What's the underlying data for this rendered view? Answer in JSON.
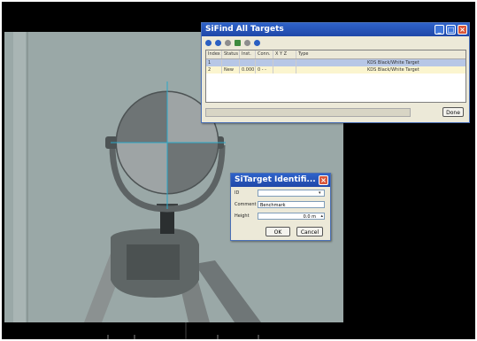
{
  "find_window": {
    "title": "SiFind All Targets",
    "columns": [
      "Index",
      "Status",
      "Inst.",
      "Conn.",
      "X Y Z",
      "Type"
    ],
    "rows": [
      {
        "index": "1",
        "status": "",
        "inst": "",
        "conn": "",
        "xyz": "",
        "type": "KDS Black/White Target"
      },
      {
        "index": "2",
        "status": "New",
        "inst": "0.000",
        "conn": "0 - -",
        "xyz": "",
        "type": "KDS Black/White Target"
      }
    ],
    "done_label": "Done"
  },
  "identify_window": {
    "title": "SiTarget Identifi...",
    "id_label": "ID",
    "id_value": "",
    "comment_label": "Comment",
    "comment_value": "Benchmark",
    "height_label": "Height",
    "height_value": "0.0 m",
    "ok_label": "OK",
    "cancel_label": "Cancel"
  },
  "colors": {
    "titlebar": "#1f47a8",
    "crosshair": "#2aa9c9",
    "viewport_bg": "#9aa8a7",
    "target_light": "#d9dfe0",
    "target_dark": "#6e7475"
  },
  "icons": {
    "toolbar": [
      "back-icon",
      "forward-icon",
      "refresh-icon",
      "add-icon",
      "delete-icon",
      "target-icon"
    ]
  }
}
